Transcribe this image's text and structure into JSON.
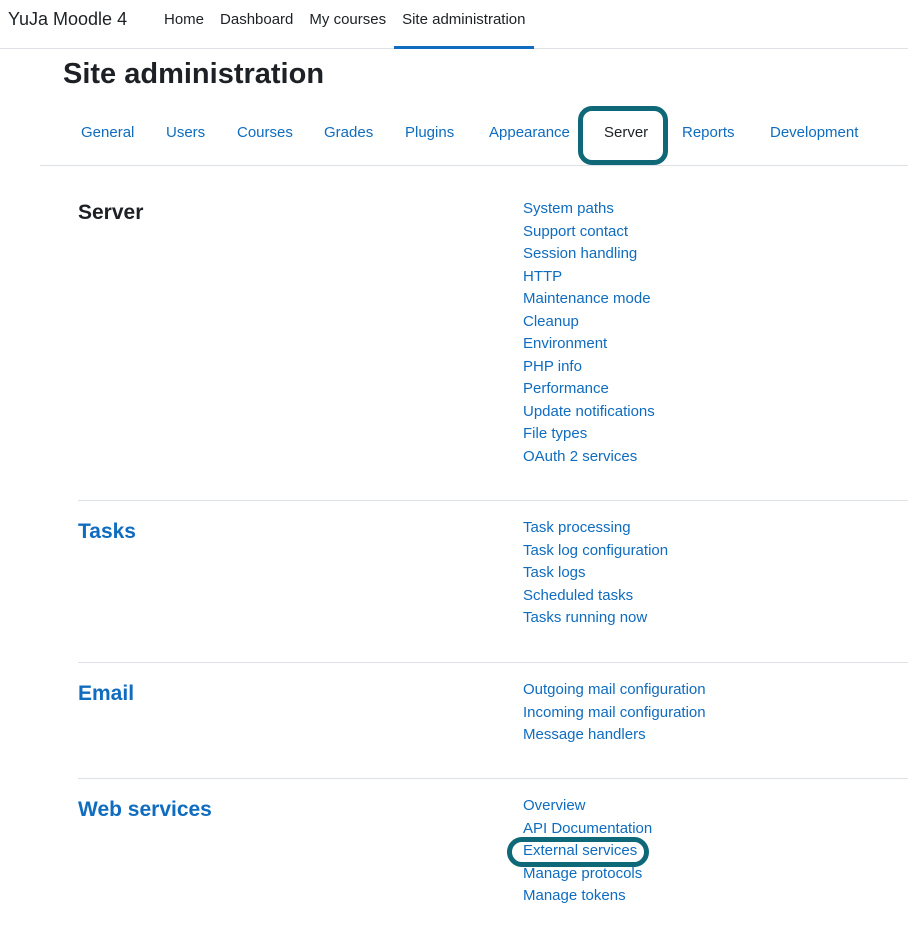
{
  "brand": "YuJa Moodle 4",
  "primary_nav": [
    "Home",
    "Dashboard",
    "My courses",
    "Site administration"
  ],
  "page_title": "Site administration",
  "secondary_nav": [
    "General",
    "Users",
    "Courses",
    "Grades",
    "Plugins",
    "Appearance",
    "Server",
    "Reports",
    "Development"
  ],
  "sections": {
    "server": {
      "heading": "Server",
      "links": [
        "System paths",
        "Support contact",
        "Session handling",
        "HTTP",
        "Maintenance mode",
        "Cleanup",
        "Environment",
        "PHP info",
        "Performance",
        "Update notifications",
        "File types",
        "OAuth 2 services"
      ]
    },
    "tasks": {
      "heading": "Tasks",
      "links": [
        "Task processing",
        "Task log configuration",
        "Task logs",
        "Scheduled tasks",
        "Tasks running now"
      ]
    },
    "email": {
      "heading": "Email",
      "links": [
        "Outgoing mail configuration",
        "Incoming mail configuration",
        "Message handlers"
      ]
    },
    "webservices": {
      "heading": "Web services",
      "links": [
        "Overview",
        "API Documentation",
        "External services",
        "Manage protocols",
        "Manage tokens"
      ]
    }
  },
  "colors": {
    "link": "#0f6cbf",
    "highlight": "#0e6877",
    "text": "#1d2125"
  }
}
